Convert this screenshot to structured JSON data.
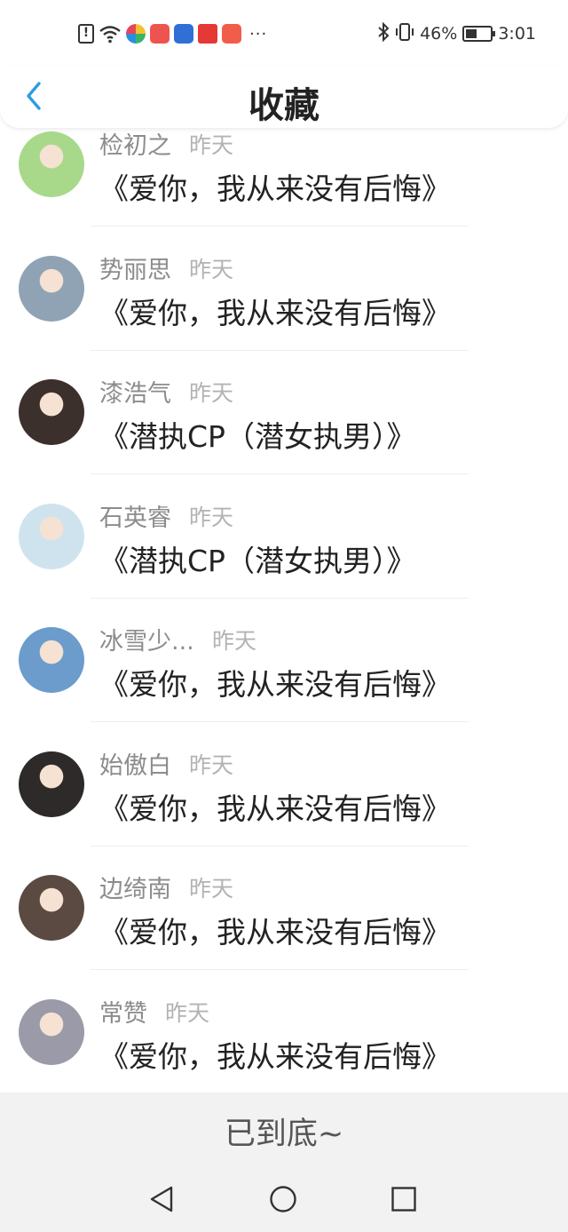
{
  "status_bar": {
    "battery_percent_label": "46%",
    "battery_level": 0.46,
    "time": "3:01",
    "more_indicator": "···",
    "left_icons": [
      "alert-icon",
      "wifi-icon",
      "app-icon-1",
      "app-icon-2",
      "app-icon-3",
      "app-icon-4",
      "app-icon-5"
    ],
    "right_icons": [
      "bluetooth-icon",
      "vibrate-icon",
      "battery-icon"
    ]
  },
  "header": {
    "title": "收藏",
    "back_icon": "chevron-left-icon",
    "accent_color": "#2a9de0"
  },
  "items": [
    {
      "name": "检初之",
      "time": "昨天",
      "title": "《爱你，我从来没有后悔》",
      "avatar_color": "#a8d98a"
    },
    {
      "name": "势丽思",
      "time": "昨天",
      "title": "《爱你，我从来没有后悔》",
      "avatar_color": "#8fa3b5"
    },
    {
      "name": "漆浩气",
      "time": "昨天",
      "title": "《潜执CP（潜女执男）》",
      "avatar_color": "#3b302c"
    },
    {
      "name": "石英睿",
      "time": "昨天",
      "title": "《潜执CP（潜女执男）》",
      "avatar_color": "#cfe3ef"
    },
    {
      "name": "冰雪少...",
      "time": "昨天",
      "title": "《爱你，我从来没有后悔》",
      "avatar_color": "#6b9ccc"
    },
    {
      "name": "始傲白",
      "time": "昨天",
      "title": "《爱你，我从来没有后悔》",
      "avatar_color": "#2e2a2a"
    },
    {
      "name": "边绮南",
      "time": "昨天",
      "title": "《爱你，我从来没有后悔》",
      "avatar_color": "#5a4a42"
    },
    {
      "name": "常赞",
      "time": "昨天",
      "title": "《爱你，我从来没有后悔》",
      "avatar_color": "#9a9aa8"
    }
  ],
  "footer": {
    "end_text": "已到底~"
  },
  "nav_bar": {
    "back_icon": "nav-back-icon",
    "home_icon": "nav-home-icon",
    "recents_icon": "nav-recents-icon"
  }
}
